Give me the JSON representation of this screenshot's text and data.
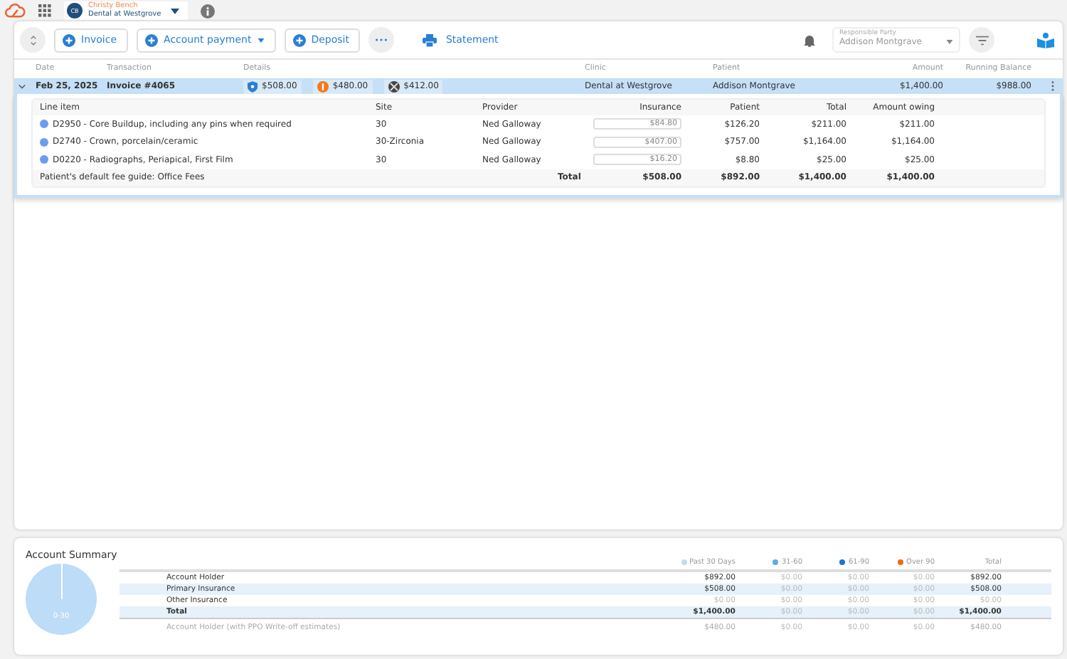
{
  "top_bar": {
    "user": {
      "initials": "CB",
      "name": "Christy Bench",
      "clinic": "Dental at Westgrove"
    }
  },
  "toolbar": {
    "buttons": [
      {
        "label": "Invoice",
        "dropdown": false
      },
      {
        "label": "Account payment",
        "dropdown": true
      },
      {
        "label": "Deposit",
        "dropdown": false
      }
    ],
    "statement": "Statement",
    "responsible_party": {
      "label": "Responsible Party",
      "value": "Addison Montgrave"
    }
  },
  "table": {
    "columns": [
      "Date",
      "Transaction",
      "Details",
      "Clinic",
      "Patient",
      "Amount",
      "Running Balance"
    ],
    "rows": [
      {
        "date": "Feb 25, 2025",
        "transaction": "Invoice #4065",
        "expanded": true,
        "selected": true,
        "details": [
          {
            "kind": "insurance",
            "amount": "$508.00"
          },
          {
            "kind": "patient",
            "amount": "$480.00"
          },
          {
            "kind": "writeoff",
            "amount": "$412.00"
          }
        ],
        "clinic": "Dental at Westgrove",
        "patient": "Addison Montgrave",
        "amount": "$1,400.00",
        "running_balance": "$988.00",
        "line_items": {
          "columns": [
            "Line item",
            "Site",
            "Provider",
            "Insurance",
            "Patient",
            "Total",
            "Amount owing"
          ],
          "rows": [
            {
              "item": "D2950 - Core Buildup, including any pins when required",
              "site": "30",
              "provider": "Ned Galloway",
              "insurance": "$84.80",
              "patient": "$126.20",
              "total": "$211.00",
              "owing": "$211.00"
            },
            {
              "item": "D2740 - Crown, porcelain/ceramic",
              "site": "30-Zirconia",
              "provider": "Ned Galloway",
              "insurance": "$407.00",
              "patient": "$757.00",
              "total": "$1,164.00",
              "owing": "$1,164.00"
            },
            {
              "item": "D0220 - Radiographs, Periapical, First Film",
              "site": "30",
              "provider": "Ned Galloway",
              "insurance": "$16.20",
              "patient": "$8.80",
              "total": "$25.00",
              "owing": "$25.00"
            }
          ],
          "footer": {
            "note": "Patient's default fee guide: Office Fees",
            "label": "Total",
            "insurance": "$508.00",
            "patient": "$892.00",
            "total": "$1,400.00",
            "owing": "$1,400.00"
          }
        }
      }
    ]
  },
  "account_summary": {
    "title": "Account Summary",
    "pie_label": "0-30",
    "legend": [
      {
        "label": "Past 30 Days",
        "color": "#bcdcf7"
      },
      {
        "label": "31-60",
        "color": "#5aaeea"
      },
      {
        "label": "61-90",
        "color": "#1a73d9"
      },
      {
        "label": "Over 90",
        "color": "#f06a0f"
      }
    ],
    "total_header": "Total",
    "rows": [
      {
        "kind": "normal",
        "label": "Account Holder",
        "cells": [
          {
            "text": "$892.00",
            "muted": false
          },
          {
            "text": "$0.00",
            "muted": true
          },
          {
            "text": "$0.00",
            "muted": true
          },
          {
            "text": "$0.00",
            "muted": true
          },
          {
            "text": "$892.00",
            "muted": false
          }
        ]
      },
      {
        "kind": "normal",
        "label": "Primary Insurance",
        "cells": [
          {
            "text": "$508.00",
            "muted": false
          },
          {
            "text": "$0.00",
            "muted": true
          },
          {
            "text": "$0.00",
            "muted": true
          },
          {
            "text": "$0.00",
            "muted": true
          },
          {
            "text": "$508.00",
            "muted": false
          }
        ]
      },
      {
        "kind": "normal",
        "label": "Other Insurance",
        "cells": [
          {
            "text": "$0.00",
            "muted": true
          },
          {
            "text": "$0.00",
            "muted": true
          },
          {
            "text": "$0.00",
            "muted": true
          },
          {
            "text": "$0.00",
            "muted": true
          },
          {
            "text": "$0.00",
            "muted": true
          }
        ]
      },
      {
        "kind": "total",
        "label": "Total",
        "cells": [
          {
            "text": "$1,400.00",
            "muted": false
          },
          {
            "text": "$0.00",
            "muted": true
          },
          {
            "text": "$0.00",
            "muted": true
          },
          {
            "text": "$0.00",
            "muted": true
          },
          {
            "text": "$1,400.00",
            "muted": false
          }
        ]
      },
      {
        "kind": "note",
        "label": "Account Holder (with PPO Write-off estimates)",
        "cells": [
          {
            "text": "$480.00",
            "muted": false
          },
          {
            "text": "$0.00",
            "muted": true
          },
          {
            "text": "$0.00",
            "muted": true
          },
          {
            "text": "$0.00",
            "muted": true
          },
          {
            "text": "$480.00",
            "muted": false
          }
        ]
      }
    ]
  }
}
